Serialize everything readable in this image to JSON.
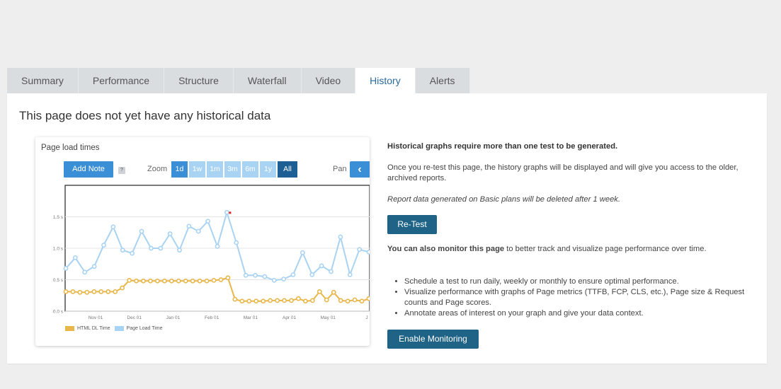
{
  "tabs": [
    {
      "label": "Summary",
      "active": false
    },
    {
      "label": "Performance",
      "active": false
    },
    {
      "label": "Structure",
      "active": false
    },
    {
      "label": "Waterfall",
      "active": false
    },
    {
      "label": "Video",
      "active": false
    },
    {
      "label": "History",
      "active": true
    },
    {
      "label": "Alerts",
      "active": false
    }
  ],
  "panel": {
    "title": "This page does not yet have any historical data"
  },
  "chart_card": {
    "title": "Page load times",
    "add_note_label": "Add Note",
    "help_label": "?",
    "zoom_label": "Zoom",
    "zoom_options": [
      "1d",
      "1w",
      "1m",
      "3m",
      "6m",
      "1y",
      "All"
    ],
    "zoom_selected": "All",
    "pan_label": "Pan",
    "pan_icon": "chevron-left-icon"
  },
  "chart_data": {
    "type": "line",
    "title": "Page load times",
    "xlabel": "",
    "ylabel": "",
    "y_ticks": [
      "0.0 s",
      "0.5 s",
      "1.0 s",
      "1.5 s"
    ],
    "ylim": [
      0,
      2.0
    ],
    "x_ticks": [
      "Nov 01",
      "Dec 01",
      "Jan 01",
      "Feb 01",
      "Mar 01",
      "Apr 01",
      "May 01",
      "J"
    ],
    "grid": true,
    "legend_position": "bottom-left",
    "series": [
      {
        "name": "HTML DL Time",
        "color": "#e9b649",
        "values": [
          0.31,
          0.31,
          0.3,
          0.3,
          0.31,
          0.31,
          0.31,
          0.31,
          0.37,
          0.49,
          0.48,
          0.48,
          0.48,
          0.48,
          0.48,
          0.48,
          0.48,
          0.48,
          0.48,
          0.48,
          0.48,
          0.49,
          0.5,
          0.53,
          0.19,
          0.16,
          0.16,
          0.16,
          0.16,
          0.17,
          0.17,
          0.17,
          0.17,
          0.2,
          0.16,
          0.17,
          0.31,
          0.18,
          0.3,
          0.17,
          0.16,
          0.18,
          0.16,
          0.2
        ]
      },
      {
        "name": "Page Load Time",
        "color": "#a9d3f3",
        "values": [
          0.68,
          0.85,
          0.62,
          0.71,
          1.05,
          1.34,
          0.97,
          0.92,
          1.27,
          1.0,
          1.0,
          1.23,
          0.97,
          1.35,
          1.27,
          1.43,
          1.03,
          1.57,
          1.09,
          0.57,
          0.57,
          0.55,
          0.49,
          0.51,
          0.58,
          0.93,
          0.58,
          0.72,
          0.63,
          1.18,
          0.58,
          0.98,
          0.94
        ]
      }
    ],
    "highlight_point": {
      "series": "Page Load Time",
      "index": 17,
      "color": "#e02020"
    }
  },
  "info": {
    "heading": "Historical graphs require more than one test to be generated.",
    "paragraph": "Once you re-test this page, the history graphs will be displayed and will give you access to the older, archived reports.",
    "note": "Report data generated on Basic plans will be deleted after 1 week.",
    "retest_label": "Re-Test",
    "monitor_bold": "You can also monitor this page",
    "monitor_rest": " to better track and visualize page performance over time.",
    "bullets": [
      "Schedule a test to run daily, weekly or monthly to ensure optimal performance.",
      "Visualize performance with graphs of Page metrics (TTFB, FCP, CLS, etc.), Page size & Request counts and Page scores.",
      "Annotate areas of interest on your graph and give your data context."
    ],
    "enable_label": "Enable Monitoring"
  },
  "colors": {
    "accent": "#3b8fd6",
    "accent_dark": "#1d5f94",
    "button_dark": "#1f6486",
    "tab_active_text": "#2b6a9a"
  }
}
